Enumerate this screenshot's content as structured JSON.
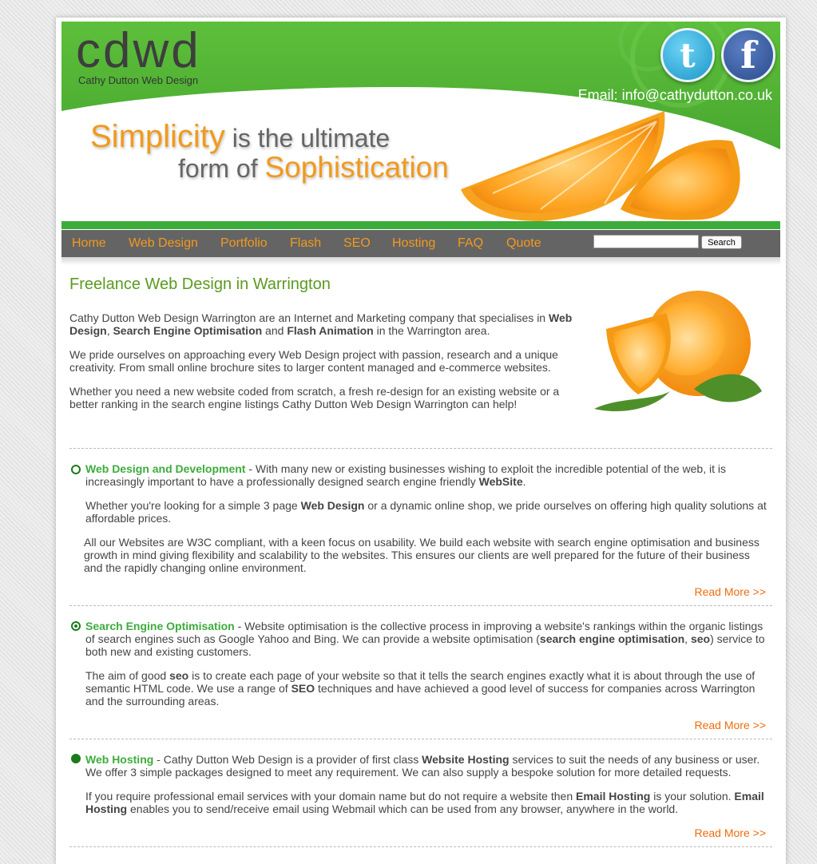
{
  "header": {
    "logo": "cdwd",
    "logo_sub": "Cathy Dutton Web Design",
    "email": "Email: info@cathydutton.co.uk",
    "tagline": {
      "highlight1": "Simplicity",
      "rest1": " is the ultimate",
      "lead2": "form of ",
      "highlight2": "Sophistication"
    }
  },
  "nav": {
    "items": [
      "Home",
      "Web Design",
      "Portfolio",
      "Flash",
      "SEO",
      "Hosting",
      "FAQ",
      "Quote"
    ],
    "search_value": "",
    "search_button": "Search"
  },
  "main": {
    "title": "Freelance Web Design in Warrington",
    "intro": {
      "p1": {
        "a": "Cathy Dutton Web Design Warrington are an Internet and Marketing company that specialises in ",
        "b1": "Web Design",
        "c": ", ",
        "b2": "Search Engine Optimisation",
        "d": " and ",
        "b3": "Flash Animation",
        "e": " in the Warrington area."
      },
      "p2": "We pride ourselves on approaching every Web Design project with passion, research and a unique creativity. From small online brochure sites to larger content managed and e-commerce websites.",
      "p3": "Whether you need a new website coded from scratch, a fresh re-design for an existing website or a better ranking in the search engine listings Cathy Dutton Web Design Warrington can help!"
    },
    "sections": [
      {
        "title": "Web Design and Development",
        "p1a": " - With many new or existing businesses wishing to exploit the incredible potential of the web, it is increasingly important to have a professionally designed search engine friendly ",
        "p1b": "WebSite",
        "p1c": ".",
        "p2a": "Whether you're looking for a simple 3 page ",
        "p2b": "Web Design",
        "p2c": " or a dynamic online shop, we pride ourselves on offering high quality solutions at affordable prices.",
        "p3": "All our Websites are W3C compliant, with a keen focus on usability. We build each website with search engine optimisation and business growth in mind giving flexibility and scalability to the websites. This ensures our clients are well prepared for the future of their business and the rapidly changing online environment.",
        "read_more": "Read More >>"
      },
      {
        "title": "Search Engine Optimisation",
        "p1a": " - Website optimisation is the collective process in improving a website's rankings within the organic listings of search engines such as Google Yahoo and Bing. We can provide a website optimisation (",
        "p1b": "search engine optimisation",
        "p1c": ", ",
        "p1d": "seo",
        "p1e": ") service to both new and existing customers.",
        "p2a": "The aim of good ",
        "p2b": "seo",
        "p2c": " is to create each page of your website so that it tells the search engines exactly what it is about through the use of semantic HTML code. We use a range of ",
        "p2d": "SEO",
        "p2e": " techniques and have achieved a good level of success for companies across Warrington and the surrounding areas.",
        "read_more": "Read More >>"
      },
      {
        "title": "Web Hosting",
        "p1a": " - Cathy Dutton Web Design is a provider of first class ",
        "p1b": "Website Hosting",
        "p1c": " services to suit the needs of any business or user. We offer 3 simple packages designed to meet any requirement. We can also supply a bespoke solution for more detailed requests.",
        "p2a": "If you require professional email services with your domain name but do not require a website then ",
        "p2b": "Email Hosting",
        "p2c": " is your solution. ",
        "p2d": "Email Hosting",
        "p2e": " enables you to send/receive email using Webmail which can be used from any browser, anywhere in the world.",
        "read_more": "Read More >>"
      }
    ]
  },
  "colors": {
    "green": "#3cac3b",
    "orange": "#f19a1d",
    "nav_bg": "#646464",
    "link_orange": "#ef6c0e"
  },
  "icons": [
    "twitter-icon",
    "facebook-icon",
    "search-icon"
  ]
}
